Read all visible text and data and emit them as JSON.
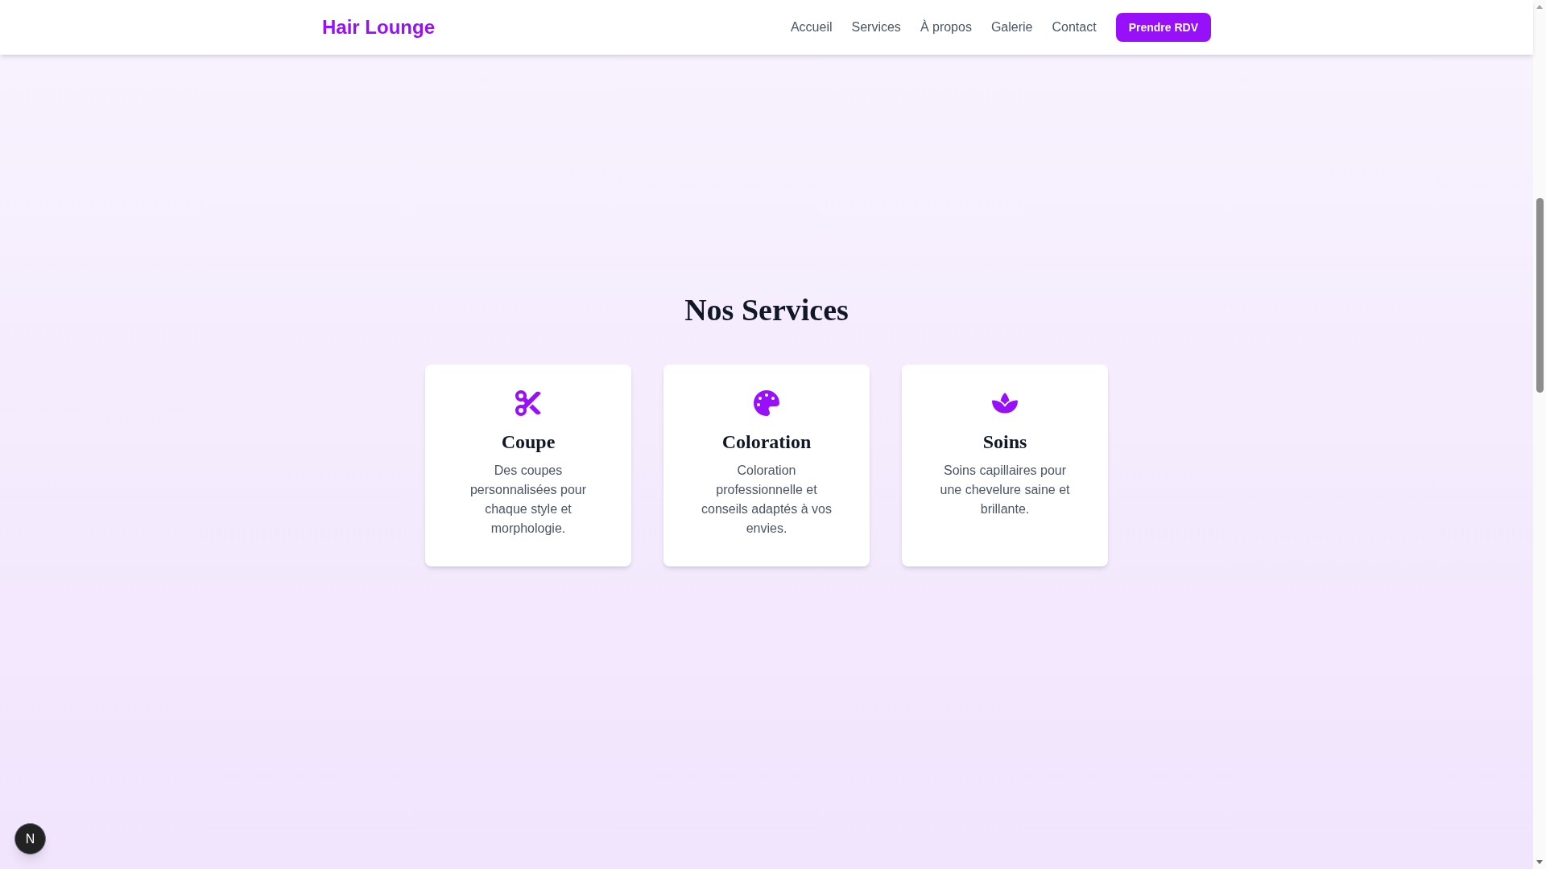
{
  "header": {
    "logo": "Hair Lounge",
    "nav": [
      {
        "label": "Accueil"
      },
      {
        "label": "Services"
      },
      {
        "label": "À propos"
      },
      {
        "label": "Galerie"
      },
      {
        "label": "Contact"
      }
    ],
    "cta": "Prendre RDV"
  },
  "services": {
    "title": "Nos Services",
    "cards": [
      {
        "kind": "scissors",
        "title": "Coupe",
        "description": "Des coupes personnalisées pour chaque style et morphologie."
      },
      {
        "kind": "palette",
        "title": "Coloration",
        "description": "Coloration professionnelle et conseils adaptés à vos envies."
      },
      {
        "kind": "lotus",
        "title": "Soins",
        "description": "Soins capillaires pour une chevelure saine et brillante."
      }
    ]
  },
  "dev_badge": {
    "label": "N"
  }
}
